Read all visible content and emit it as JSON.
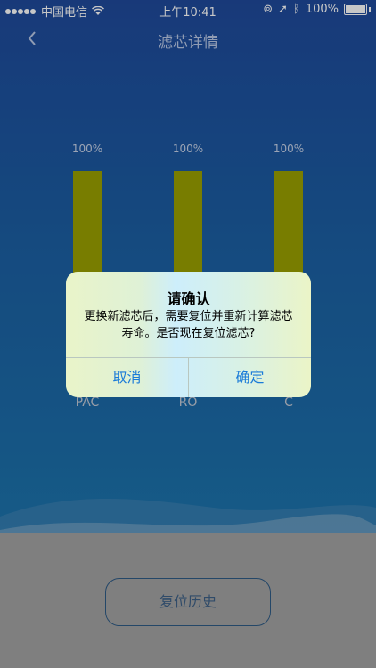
{
  "status_bar": {
    "carrier": "中国电信",
    "time": "上午10:41",
    "battery": "100%"
  },
  "nav": {
    "title": "滤芯详情"
  },
  "filters": [
    {
      "name": "PAC",
      "percent_text": "100%",
      "level": 1.0
    },
    {
      "name": "RO",
      "percent_text": "100%",
      "level": 1.0
    },
    {
      "name": "C",
      "percent_text": "100%",
      "level": 1.0
    }
  ],
  "dialog": {
    "title": "请确认",
    "message": "更换新滤芯后，需要复位并重新计算滤芯寿命。是否现在复位滤芯?",
    "cancel": "取消",
    "confirm": "确定"
  },
  "buttons": {
    "history": "复位历史"
  },
  "colors": {
    "bar": "#9aa100",
    "accent": "#1a7bd8",
    "background": "#1b5fa3"
  }
}
